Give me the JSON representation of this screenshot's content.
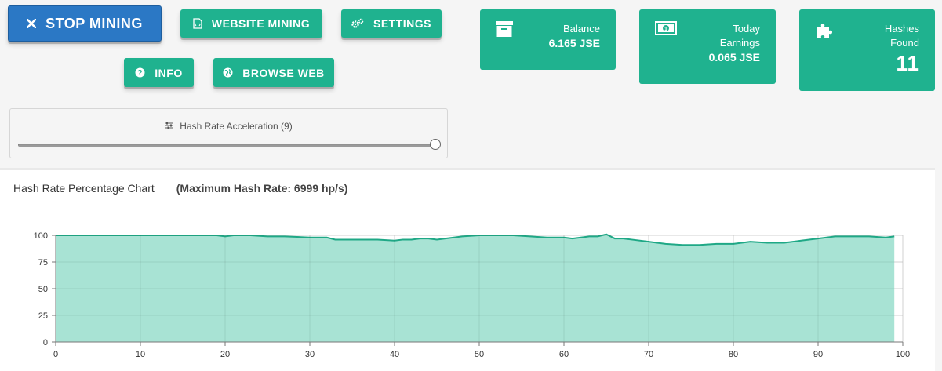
{
  "buttons": {
    "stop_mining": "STOP MINING",
    "website_mining": "WEBSITE MINING",
    "settings": "SETTINGS",
    "info": "INFO",
    "browse_web": "BROWSE WEB"
  },
  "cards": {
    "balance": {
      "label": "Balance",
      "value": "6.165 JSE",
      "icon": "archive-icon"
    },
    "today_earnings": {
      "label_line1": "Today",
      "label_line2": "Earnings",
      "value": "0.065 JSE",
      "icon": "money-icon"
    },
    "hashes_found": {
      "label_line1": "Hashes",
      "label_line2": "Found",
      "value": "11",
      "icon": "puzzle-icon"
    }
  },
  "slider": {
    "label": "Hash Rate Acceleration (9)",
    "level_fraction": 1.0
  },
  "chart_panel": {
    "title": "Hash Rate Percentage Chart",
    "subtitle": "(Maximum Hash Rate: 6999 hp/s)"
  },
  "colors": {
    "accent_green": "#1fb28f",
    "stop_blue": "#2b78c5",
    "chart_fill": "#a3e2d2",
    "chart_line": "#1fa886"
  },
  "chart_data": {
    "type": "area",
    "xlabel": "",
    "ylabel": "",
    "xlim": [
      0,
      100
    ],
    "ylim": [
      0,
      100
    ],
    "x_ticks": [
      0,
      10,
      20,
      30,
      40,
      50,
      60,
      70,
      80,
      90,
      100
    ],
    "y_ticks": [
      0,
      25,
      50,
      75,
      100
    ],
    "grid": true,
    "series": [
      {
        "x": [
          0,
          5,
          10,
          15,
          19,
          20,
          21,
          23,
          25,
          27,
          30,
          31,
          32,
          33,
          35,
          38,
          40,
          41,
          42,
          43,
          44,
          45,
          46,
          47,
          48,
          50,
          52,
          54,
          56,
          58,
          60,
          61,
          62,
          63,
          64,
          65,
          66,
          67,
          68,
          70,
          72,
          74,
          76,
          78,
          80,
          82,
          84,
          86,
          88,
          90,
          92,
          94,
          96,
          98,
          99
        ],
        "y": [
          100,
          100,
          100,
          100,
          100,
          99,
          100,
          100,
          99,
          99,
          98,
          98,
          98,
          96,
          96,
          96,
          95,
          96,
          96,
          97,
          97,
          96,
          97,
          98,
          99,
          100,
          100,
          100,
          99,
          98,
          98,
          97,
          98,
          99,
          99,
          101,
          97,
          97,
          96,
          94,
          92,
          91,
          91,
          92,
          92,
          94,
          93,
          93,
          95,
          97,
          99,
          99,
          99,
          98,
          99
        ]
      }
    ]
  }
}
